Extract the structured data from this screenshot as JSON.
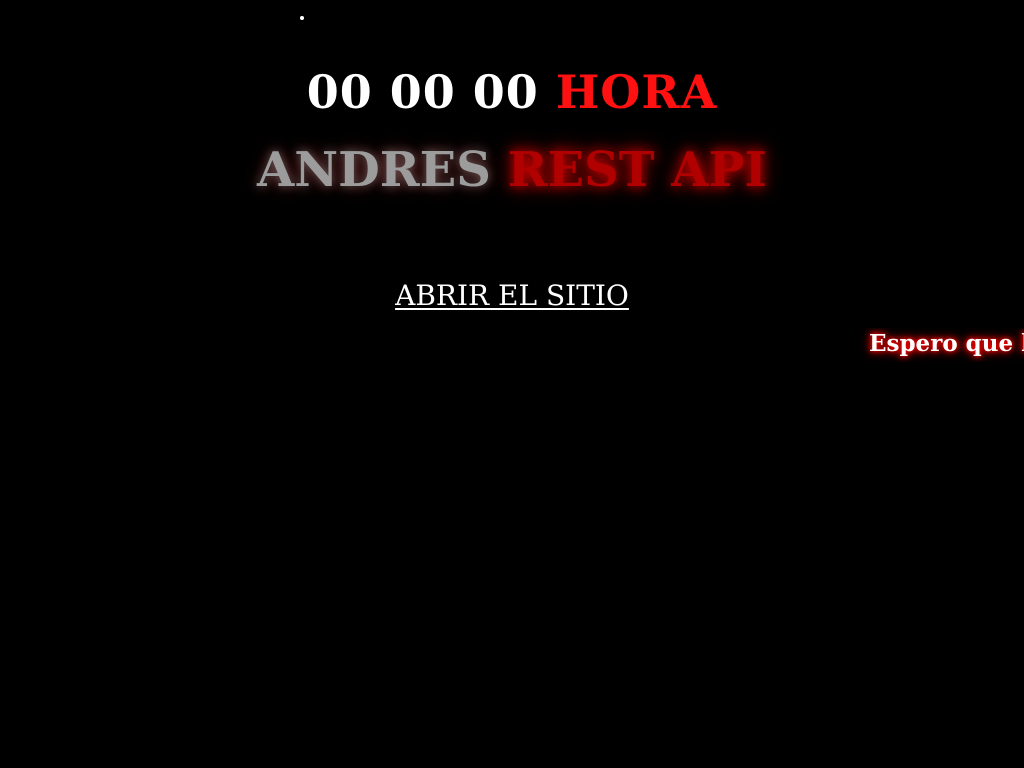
{
  "clock": {
    "time": "00 00 00",
    "label": "HORA"
  },
  "brand": {
    "first": "ANDRES",
    "second": "REST API"
  },
  "link": {
    "label": "ABRIR EL SITIO"
  },
  "marquee": {
    "text": "Espero que le"
  },
  "colors": {
    "background": "#000000",
    "accent_red": "#ff1111",
    "dark_red": "#b00000",
    "gray": "#9c9c9c",
    "white": "#ffffff"
  }
}
